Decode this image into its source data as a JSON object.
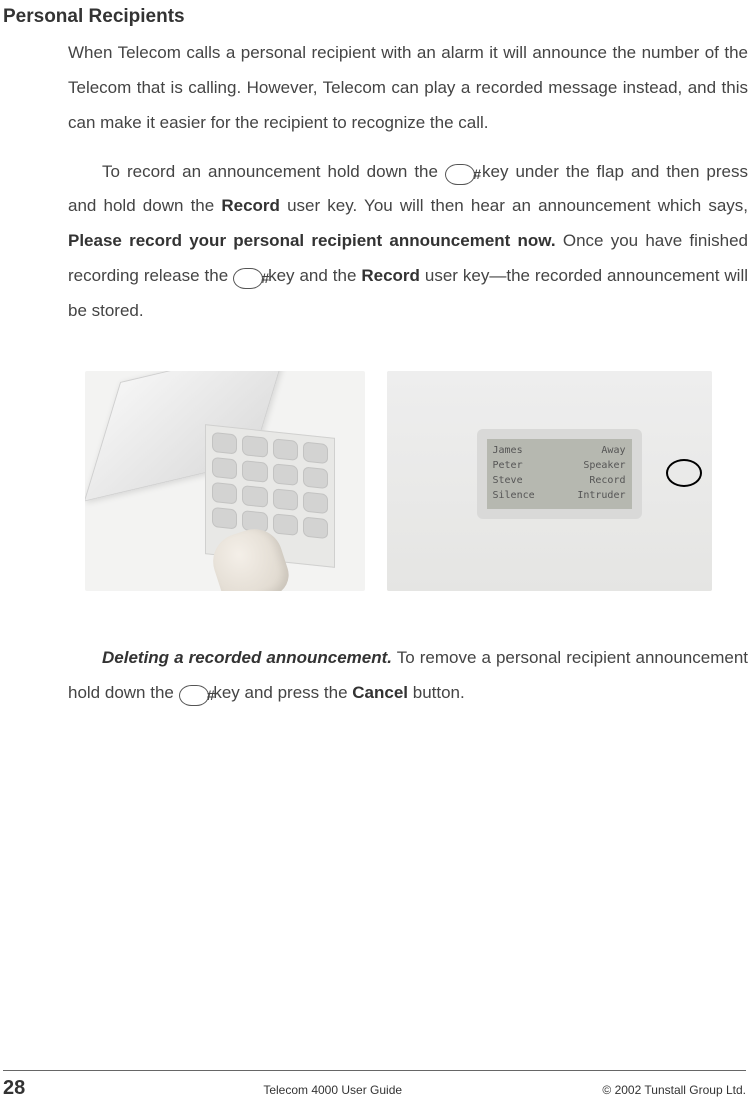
{
  "heading": "Personal Recipients",
  "para1": "When Telecom calls a personal recipient with an alarm it will announce the number of the Telecom that is calling. However, Telecom can play a recorded message instead, and this can make it easier for the recipient to recognize the call.",
  "para2_a": "To record an announcement hold down the ",
  "para2_b": " key under the flap and then press and hold down the ",
  "record_label": "Record",
  "para2_c": " user key. You will then hear an announcement which says, ",
  "prompt_text": "Please record your personal recipient announcement now.",
  "para2_d": " Once you have finished recording release the ",
  "para2_e": " key and the ",
  "para2_f": " user key—the recorded announcement will be stored.",
  "hash_symbol": "#",
  "screen": {
    "l1": "James",
    "r1": "Away",
    "l2": "Peter",
    "r2": "Speaker",
    "l3": "Steve",
    "r3": "Record",
    "l4": "Silence",
    "r4": "Intruder"
  },
  "para3_lead": "Deleting a recorded announcement.",
  "para3_a": " To remove a personal recipient announcement hold down the ",
  "para3_b": " key and press the ",
  "cancel_label": "Cancel",
  "para3_c": " button.",
  "footer": {
    "page": "28",
    "center": "Telecom 4000 User Guide",
    "right": "© 2002 Tunstall Group Ltd."
  }
}
